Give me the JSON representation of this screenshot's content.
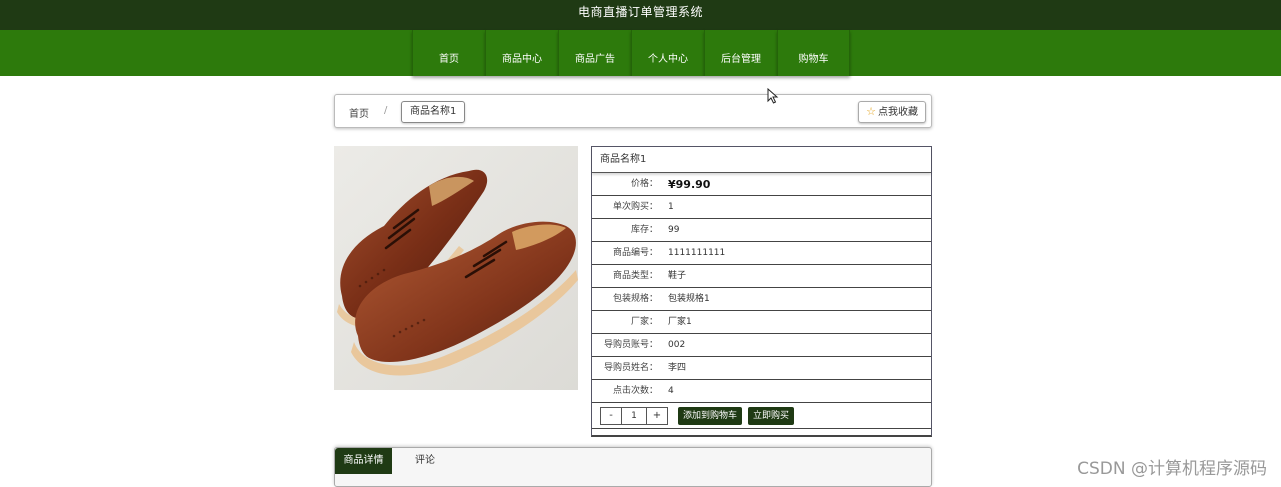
{
  "site_title": "电商直播订单管理系统",
  "nav": [
    "首页",
    "商品中心",
    "商品广告",
    "个人中心",
    "后台管理",
    "购物车"
  ],
  "breadcrumb": {
    "home": "首页",
    "separator": "/",
    "current": "商品名称1"
  },
  "favorite_label": "点我收藏",
  "product": {
    "name": "商品名称1",
    "price_label": "价格：",
    "price": "¥99.90",
    "fields": [
      {
        "label": "单次购买：",
        "value": "1"
      },
      {
        "label": "库存：",
        "value": "99"
      },
      {
        "label": "商品编号：",
        "value": "1111111111"
      },
      {
        "label": "商品类型：",
        "value": "鞋子"
      },
      {
        "label": "包装规格：",
        "value": "包装规格1"
      },
      {
        "label": "厂家：",
        "value": "厂家1"
      },
      {
        "label": "导购员账号：",
        "value": "002"
      },
      {
        "label": "导购员姓名：",
        "value": "李四"
      },
      {
        "label": "点击次数：",
        "value": "4"
      }
    ]
  },
  "quantity": {
    "minus": "-",
    "value": "1",
    "plus": "+"
  },
  "buttons": {
    "add_to_cart": "添加到购物车",
    "buy_now": "立即购买"
  },
  "tabs": [
    "商品详情",
    "评论"
  ],
  "watermark": "CSDN @计算机程序源码",
  "colors": {
    "header_dark": "#1f3a14",
    "nav_green": "#2d7a0c"
  }
}
